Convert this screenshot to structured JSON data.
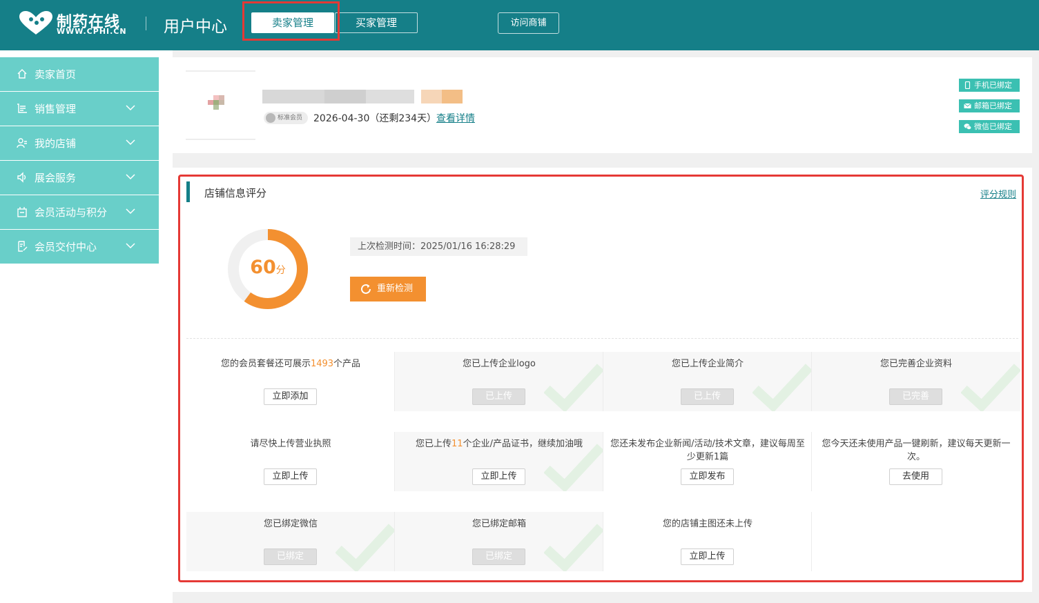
{
  "header": {
    "logo_name": "制药在线",
    "logo_url": "WWW.CPHI.CN",
    "center_title": "用户中心",
    "tabs": [
      {
        "label": "卖家管理",
        "active": true
      },
      {
        "label": "买家管理",
        "active": false
      }
    ],
    "visit_store": "访问商铺",
    "colors": {
      "primary": "#157f88",
      "menu": "#69cfc9",
      "accent": "#f39030",
      "highlight_frame": "#e53935"
    }
  },
  "sidebar": {
    "items": [
      {
        "label": "卖家首页",
        "icon": "home-icon"
      },
      {
        "label": "销售管理",
        "icon": "sales-list-icon"
      },
      {
        "label": "我的店铺",
        "icon": "user-store-icon"
      },
      {
        "label": "展会服务",
        "icon": "speaker-icon"
      },
      {
        "label": "会员活动与积分",
        "icon": "gift-card-icon"
      },
      {
        "label": "会员交付中心",
        "icon": "document-edit-icon"
      }
    ]
  },
  "profile": {
    "member_badge": "标准会员",
    "expire_text": "2026-04-30（还剩234天）",
    "detail_link": "查看详情",
    "bind_tags": [
      {
        "label": "手机已绑定",
        "icon": "phone-icon"
      },
      {
        "label": "邮箱已绑定",
        "icon": "mail-icon"
      },
      {
        "label": "微信已绑定",
        "icon": "wechat-icon"
      }
    ]
  },
  "score": {
    "section_title": "店铺信息评分",
    "rule_link": "评分规则",
    "value": 60,
    "value_text": "60",
    "unit": "分",
    "last_check": "上次检测时间：2025/01/16 16:28:29",
    "recheck_label": "重新检测",
    "tasks": [
      {
        "pre": "您的会员套餐还可展示",
        "hl": "1493",
        "post": "个产品",
        "button": "立即添加",
        "done": false
      },
      {
        "pre": "您已上传企业logo",
        "hl": "",
        "post": "",
        "button": "已上传",
        "done": true
      },
      {
        "pre": "您已上传企业简介",
        "hl": "",
        "post": "",
        "button": "已上传",
        "done": true
      },
      {
        "pre": "您已完善企业资料",
        "hl": "",
        "post": "",
        "button": "已完善",
        "done": true
      },
      {
        "pre": "请尽快上传营业执照",
        "hl": "",
        "post": "",
        "button": "立即上传",
        "done": false
      },
      {
        "pre": "您已上传",
        "hl": "11",
        "post": "个企业/产品证书，继续加油哦",
        "button": "立即上传",
        "done": true
      },
      {
        "pre": "您还未发布企业新闻/活动/技术文章，建议每周至少更新1篇",
        "hl": "",
        "post": "",
        "button": "立即发布",
        "done": false
      },
      {
        "pre": "您今天还未使用产品一键刷新，建议每天更新一次。",
        "hl": "",
        "post": "",
        "button": "去使用",
        "done": false
      },
      {
        "pre": "您已绑定微信",
        "hl": "",
        "post": "",
        "button": "已绑定",
        "done": true
      },
      {
        "pre": "您已绑定邮箱",
        "hl": "",
        "post": "",
        "button": "已绑定",
        "done": true
      },
      {
        "pre": "您的店铺主图还未上传",
        "hl": "",
        "post": "",
        "button": "立即上传",
        "done": false
      }
    ]
  }
}
